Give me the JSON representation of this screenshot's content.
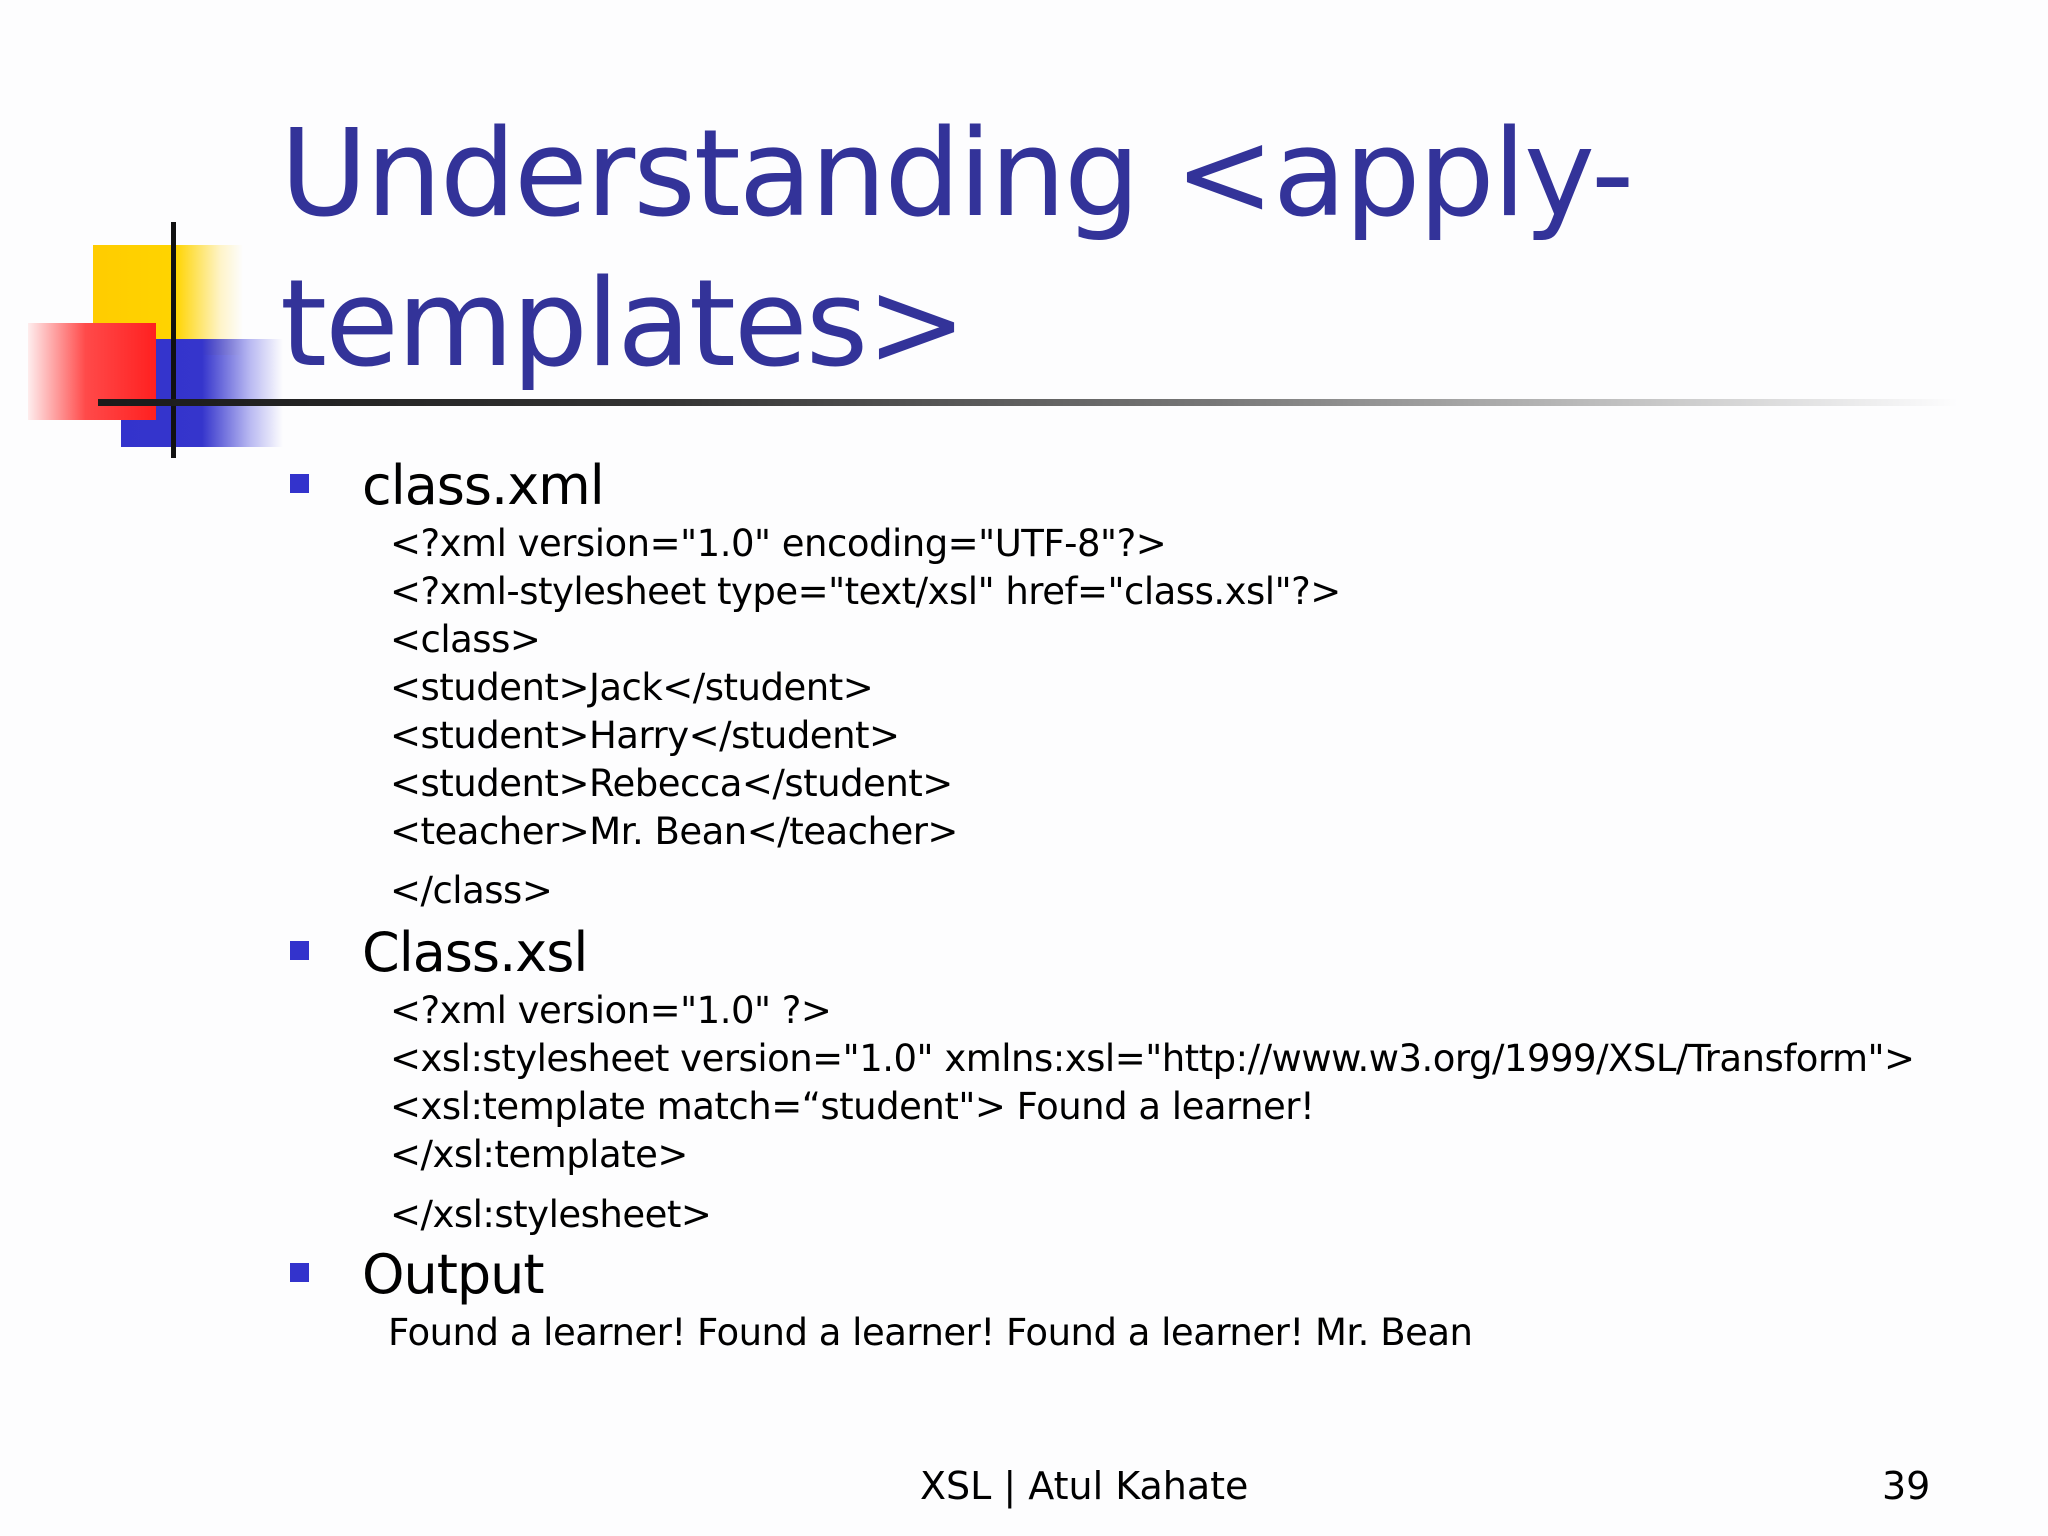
{
  "slide": {
    "title": "Understanding <apply-templates>",
    "sections": [
      {
        "heading": "class.xml",
        "lines": [
          "<?xml version=\"1.0\" encoding=\"UTF-8\"?>",
          "<?xml-stylesheet type=\"text/xsl\" href=\"class.xsl\"?>",
          "<class>",
          "<student>Jack</student>",
          "<student>Harry</student>",
          "<student>Rebecca</student>",
          "<teacher>Mr. Bean</teacher>",
          "</class>"
        ]
      },
      {
        "heading": "Class.xsl",
        "lines": [
          "<?xml version=\"1.0\" ?>",
          "<xsl:stylesheet version=\"1.0\" xmlns:xsl=\"http://www.w3.org/1999/XSL/Transform\">",
          "<xsl:template match=“student\"> Found a learner!",
          "</xsl:template>",
          "</xsl:stylesheet>"
        ]
      },
      {
        "heading": "Output",
        "lines": [
          "Found a learner! Found a learner! Found a learner! Mr. Bean"
        ]
      }
    ],
    "footer": {
      "center_text": "XSL | Atul Kahate",
      "page_number": "39"
    },
    "colors": {
      "title": "#333399",
      "bullet": "#3333cc",
      "deco_yellow": "#ffcc00",
      "deco_red": "#ff2020",
      "deco_blue": "#3333cc"
    }
  }
}
